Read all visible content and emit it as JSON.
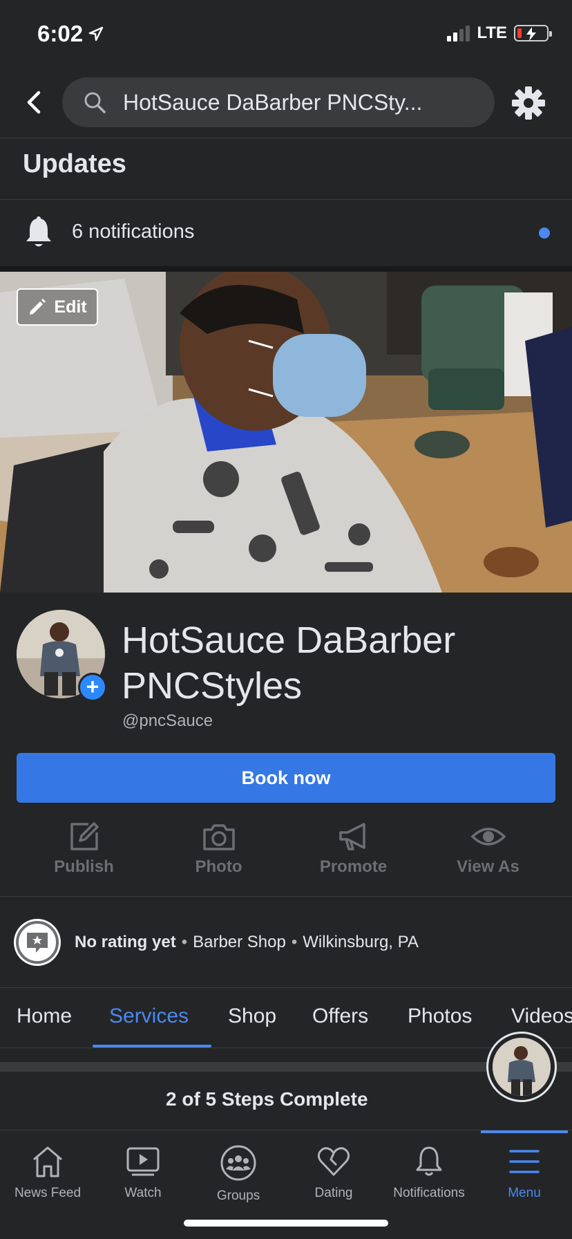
{
  "status_bar": {
    "time": "6:02",
    "network": "LTE"
  },
  "search": {
    "query": "HotSauce DaBarber PNCSty..."
  },
  "updates": {
    "title": "Updates",
    "notifications_text": "6 notifications"
  },
  "cover": {
    "edit_label": "Edit"
  },
  "profile": {
    "name": "HotSauce DaBarber PNCStyles",
    "handle": "@pncSauce"
  },
  "book_button": {
    "label": "Book now"
  },
  "actions": [
    {
      "label": "Publish",
      "icon": "compose-icon"
    },
    {
      "label": "Photo",
      "icon": "camera-icon"
    },
    {
      "label": "Promote",
      "icon": "megaphone-icon"
    },
    {
      "label": "View As",
      "icon": "eye-icon"
    }
  ],
  "info": {
    "rating": "No rating yet",
    "category": "Barber Shop",
    "location": "Wilkinsburg, PA"
  },
  "tabs": [
    "Home",
    "Services",
    "Shop",
    "Offers",
    "Photos",
    "Videos"
  ],
  "active_tab": "Services",
  "steps": {
    "text": "2 of 5 Steps Complete"
  },
  "bottom_nav": [
    {
      "label": "News Feed",
      "icon": "home-icon"
    },
    {
      "label": "Watch",
      "icon": "play-icon"
    },
    {
      "label": "Groups",
      "icon": "groups-icon"
    },
    {
      "label": "Dating",
      "icon": "heart-icon"
    },
    {
      "label": "Notifications",
      "icon": "bell-icon"
    },
    {
      "label": "Menu",
      "icon": "menu-icon"
    }
  ],
  "colors": {
    "accent": "#4a89f3",
    "book_button": "#3578e5",
    "background": "#242526"
  }
}
